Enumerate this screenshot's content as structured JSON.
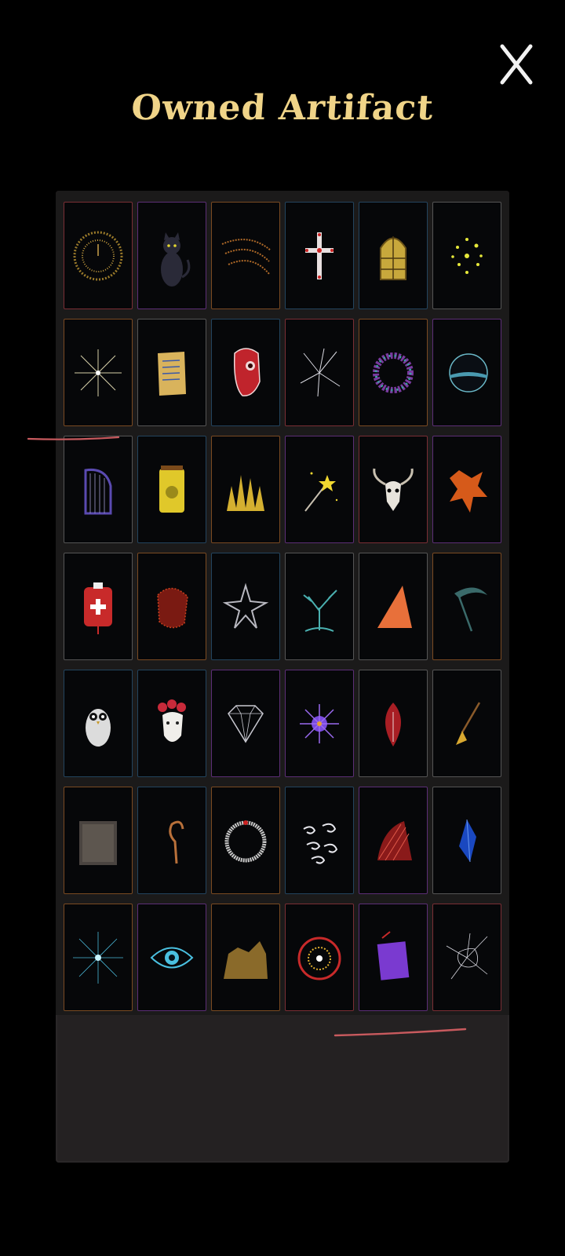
{
  "header": {
    "title": "Owned Artifact",
    "close_icon": "close-icon"
  },
  "colors": {
    "title": "#f0d488",
    "background": "#000000",
    "panel": "#242122",
    "pen_marks": "#c85a5e"
  },
  "artifacts": [
    {
      "icon": "golden-clock-icon",
      "border": "red"
    },
    {
      "icon": "black-cat-icon",
      "border": "purple"
    },
    {
      "icon": "amber-scratches-icon",
      "border": "orange"
    },
    {
      "icon": "holy-cross-icon",
      "border": "blue"
    },
    {
      "icon": "stained-glass-window-icon",
      "border": "blue"
    },
    {
      "icon": "yellow-spores-icon",
      "border": "gray"
    },
    {
      "icon": "radiant-star-icon",
      "border": "orange"
    },
    {
      "icon": "ancient-scroll-icon",
      "border": "gray"
    },
    {
      "icon": "red-mask-icon",
      "border": "blue"
    },
    {
      "icon": "shattered-burst-icon",
      "border": "red"
    },
    {
      "icon": "flower-wreath-icon",
      "border": "orange"
    },
    {
      "icon": "dark-moon-icon",
      "border": "purple"
    },
    {
      "icon": "harp-icon",
      "border": "gray"
    },
    {
      "icon": "yellow-jar-icon",
      "border": "blue"
    },
    {
      "icon": "golden-crown-spikes-icon",
      "border": "orange"
    },
    {
      "icon": "magic-wand-icon",
      "border": "purple"
    },
    {
      "icon": "goat-skull-icon",
      "border": "red"
    },
    {
      "icon": "orange-splatter-icon",
      "border": "purple"
    },
    {
      "icon": "blood-bag-icon",
      "border": "gray"
    },
    {
      "icon": "red-face-icon",
      "border": "orange"
    },
    {
      "icon": "spiked-star-icon",
      "border": "blue"
    },
    {
      "icon": "dead-tree-icon",
      "border": "gray"
    },
    {
      "icon": "orange-shard-icon",
      "border": "gray"
    },
    {
      "icon": "scythe-icon",
      "border": "orange"
    },
    {
      "icon": "owl-icon",
      "border": "blue"
    },
    {
      "icon": "rose-mask-icon",
      "border": "blue"
    },
    {
      "icon": "diamond-icon",
      "border": "purple"
    },
    {
      "icon": "purple-urchin-icon",
      "border": "purple"
    },
    {
      "icon": "red-leaf-icon",
      "border": "gray"
    },
    {
      "icon": "broom-icon",
      "border": "gray"
    },
    {
      "icon": "static-noise-icon",
      "border": "orange"
    },
    {
      "icon": "rope-icon",
      "border": "blue"
    },
    {
      "icon": "ouroboros-icon",
      "border": "orange"
    },
    {
      "icon": "swirling-winds-icon",
      "border": "blue"
    },
    {
      "icon": "red-fan-icon",
      "border": "purple"
    },
    {
      "icon": "blue-crystal-icon",
      "border": "gray"
    },
    {
      "icon": "cyan-burst-icon",
      "border": "orange"
    },
    {
      "icon": "all-seeing-eye-icon",
      "border": "purple"
    },
    {
      "icon": "golden-mound-icon",
      "border": "orange"
    },
    {
      "icon": "sun-wheel-icon",
      "border": "red"
    },
    {
      "icon": "purple-tome-icon",
      "border": "purple"
    },
    {
      "icon": "spider-web-icon",
      "border": "red"
    }
  ]
}
